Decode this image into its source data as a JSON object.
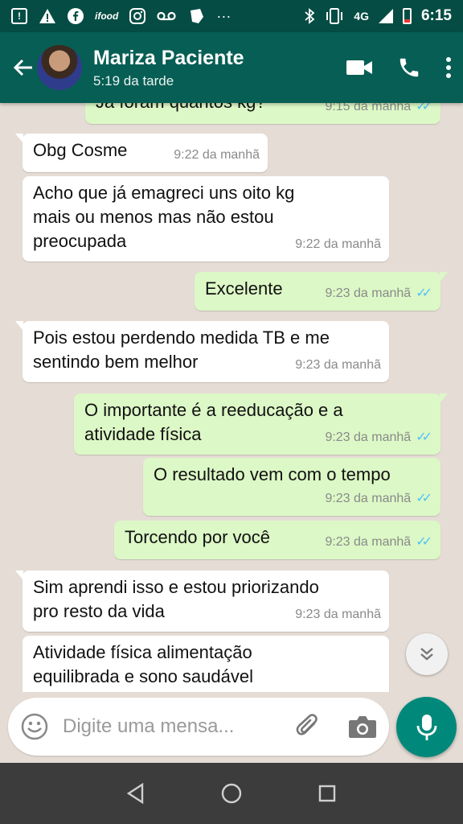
{
  "status_bar": {
    "network": "4G",
    "time": "6:15",
    "ifood": "ifood"
  },
  "header": {
    "contact_name": "Mariza Paciente",
    "last_seen": "5:19 da tarde"
  },
  "messages": [
    {
      "dir": "out",
      "text": "Já foram quantos kg?",
      "time": "9:15 da manhã",
      "read": true
    },
    {
      "dir": "in",
      "text": "Obg Cosme",
      "time": "9:22 da manhã"
    },
    {
      "dir": "in",
      "text": "Acho que já emagreci uns oito kg\nmais ou menos mas não estou\npreocupada",
      "time": "9:22 da manhã"
    },
    {
      "dir": "out",
      "text": "Excelente",
      "time": "9:23 da manhã",
      "read": true
    },
    {
      "dir": "in",
      "text": "Pois estou perdendo medida TB e me\nsentindo bem melhor",
      "time": "9:23 da manhã"
    },
    {
      "dir": "out",
      "text": "O importante é a reeducação e a\natividade física",
      "time": "9:23 da manhã",
      "read": true
    },
    {
      "dir": "out",
      "text": "O resultado vem com o tempo",
      "time": "9:23 da manhã",
      "read": true
    },
    {
      "dir": "out",
      "text": "Torcendo por você",
      "time": "9:23 da manhã",
      "read": true
    },
    {
      "dir": "in",
      "text": "Sim aprendi isso e estou priorizando\npro resto da vida",
      "time": "9:23 da manhã"
    },
    {
      "dir": "in",
      "text": "Atividade física alimentação\nequilibrada e sono saudável",
      "time": ""
    }
  ],
  "composer": {
    "placeholder": "Digite uma mensa..."
  },
  "icons": {
    "back": "arrow-left",
    "video": "video-camera",
    "call": "phone",
    "menu": "more-vert",
    "emoji": "smiley",
    "attach": "paperclip",
    "camera": "camera",
    "mic": "microphone",
    "scroll": "double-chevron-down"
  },
  "colors": {
    "header": "#075e54",
    "status_bar": "#054d44",
    "chat_bg": "#e5ddd5",
    "outgoing_bubble": "#dcf8c6",
    "incoming_bubble": "#ffffff",
    "read_ticks": "#4fc3f7",
    "fab": "#00897b"
  }
}
